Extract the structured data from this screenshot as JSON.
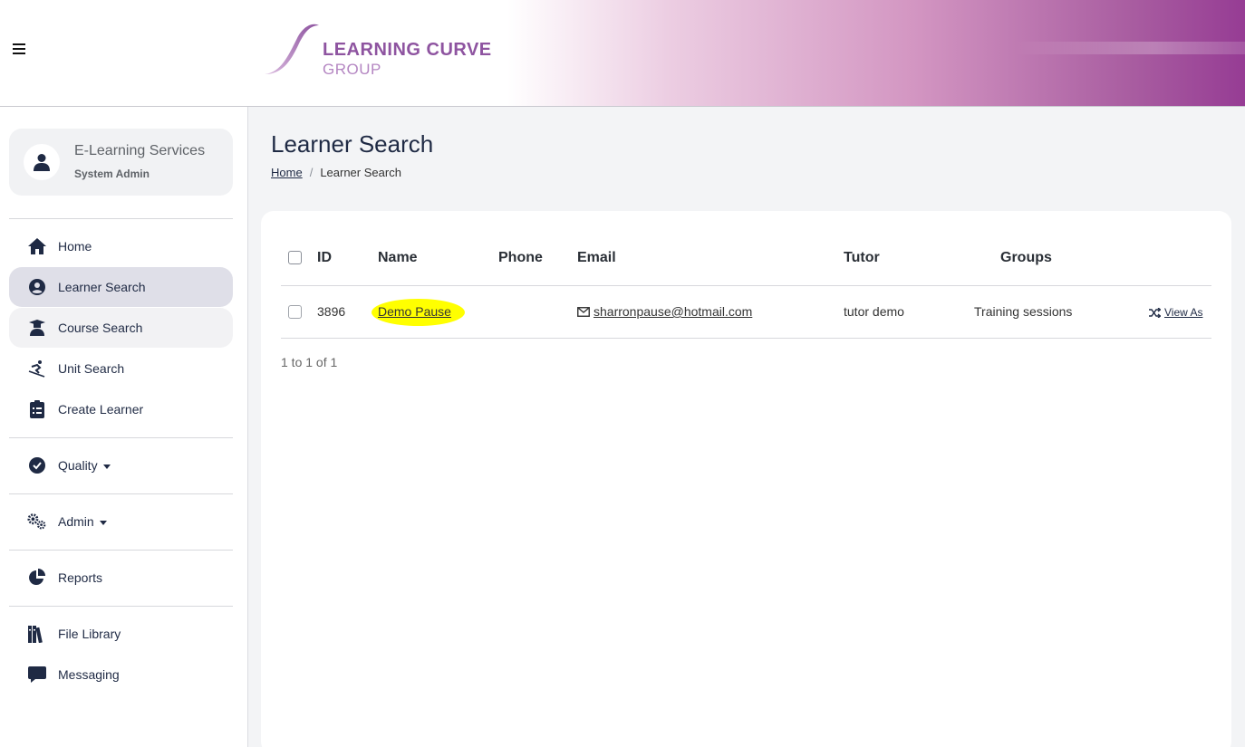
{
  "header": {
    "logo_line1": "LEARNING CURVE",
    "logo_line2": "GROUP",
    "brand_color": "#8e54a0"
  },
  "user": {
    "name": "E-Learning Services",
    "role": "System Admin"
  },
  "sidebar": {
    "items": [
      {
        "label": "Home",
        "icon": "home-icon"
      },
      {
        "label": "Learner Search",
        "icon": "user-circle-icon",
        "active": true
      },
      {
        "label": "Course Search",
        "icon": "graduate-icon"
      },
      {
        "label": "Unit Search",
        "icon": "skier-icon"
      },
      {
        "label": "Create Learner",
        "icon": "clipboard-list-icon"
      },
      {
        "label": "Quality",
        "icon": "check-circle-icon",
        "dropdown": true
      },
      {
        "label": "Admin",
        "icon": "gears-icon",
        "dropdown": true
      },
      {
        "label": "Reports",
        "icon": "pie-chart-icon"
      },
      {
        "label": "File Library",
        "icon": "books-icon"
      },
      {
        "label": "Messaging",
        "icon": "message-icon"
      }
    ]
  },
  "page": {
    "title": "Learner Search",
    "breadcrumb": {
      "home": "Home",
      "separator": "/",
      "current": "Learner Search"
    }
  },
  "table": {
    "columns": [
      "ID",
      "Name",
      "Phone",
      "Email",
      "Tutor",
      "Groups"
    ],
    "rows": [
      {
        "id": "3896",
        "name": "Demo Pause",
        "phone": "",
        "email": "sharronpause@hotmail.com",
        "tutor": "tutor demo",
        "groups": "Training sessions",
        "action": "View As"
      }
    ],
    "pagination": "1 to 1 of 1"
  },
  "colors": {
    "highlight": "#ffff00",
    "active_nav": "#dfdfe8",
    "text_dark": "#1f2a44"
  }
}
